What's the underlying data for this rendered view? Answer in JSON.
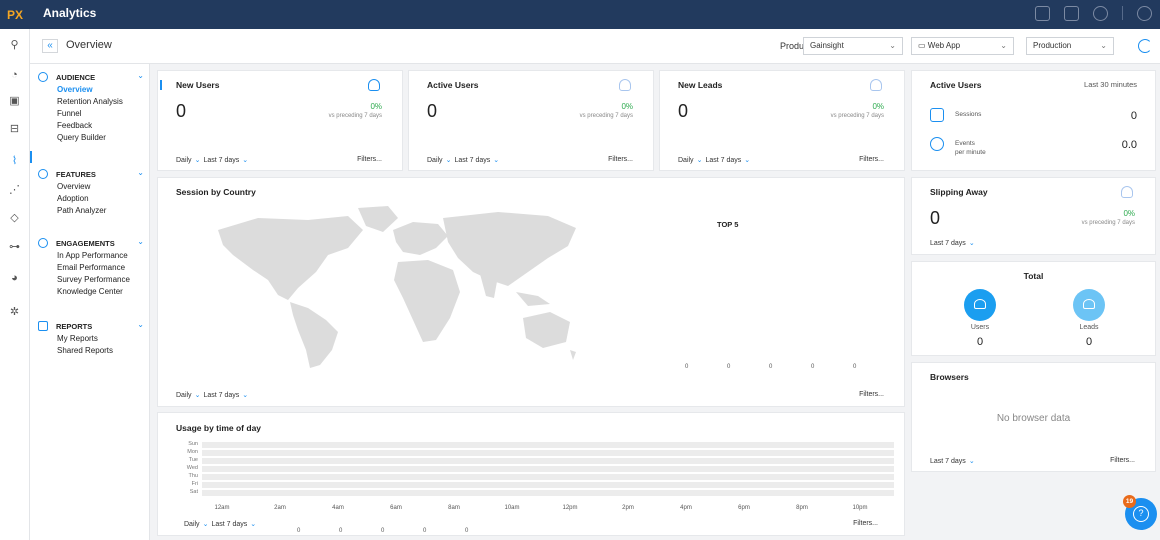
{
  "app": {
    "logo": "PX",
    "title": "Analytics"
  },
  "top_icons": [
    "chat-icon",
    "book-icon",
    "globe-icon",
    "info-icon"
  ],
  "header": {
    "back_glyph": "«",
    "page_title": "Overview",
    "product_label": "Product",
    "product_value": "Gainsight",
    "app_value": "Web App",
    "env_value": "Production"
  },
  "rail_icons": [
    "search-icon",
    "speed-icon",
    "dashboard-icon",
    "briefcase-icon",
    "analytics-icon",
    "route-icon",
    "graduation-icon",
    "hierarchy-icon",
    "pie-chart-icon",
    "settings-icon"
  ],
  "nav": {
    "sections": [
      {
        "title": "AUDIENCE",
        "items": [
          "Overview",
          "Retention Analysis",
          "Funnel",
          "Feedback",
          "Query Builder"
        ],
        "active": 0
      },
      {
        "title": "FEATURES",
        "items": [
          "Overview",
          "Adoption",
          "Path Analyzer"
        ]
      },
      {
        "title": "ENGAGEMENTS",
        "items": [
          "In App Performance",
          "Email Performance",
          "Survey Performance",
          "Knowledge Center"
        ]
      },
      {
        "title": "REPORTS",
        "items": [
          "My Reports",
          "Shared Reports"
        ]
      }
    ]
  },
  "cards": {
    "new_users": {
      "title": "New Users",
      "value": "0",
      "pct": "0%",
      "vs": "vs preceding 7 days",
      "period": "Daily",
      "range": "Last 7 days",
      "filters": "Filters..."
    },
    "active_users": {
      "title": "Active Users",
      "value": "0",
      "pct": "0%",
      "vs": "vs preceding 7 days",
      "period": "Daily",
      "range": "Last 7 days",
      "filters": "Filters..."
    },
    "new_leads": {
      "title": "New Leads",
      "value": "0",
      "pct": "0%",
      "vs": "vs preceding 7 days",
      "period": "Daily",
      "range": "Last 7 days",
      "filters": "Filters..."
    },
    "session_country": {
      "title": "Session by Country",
      "top_label": "TOP 5",
      "top_values": [
        "0",
        "0",
        "0",
        "0",
        "0"
      ],
      "period": "Daily",
      "range": "Last 7 days",
      "filters": "Filters..."
    },
    "usage_time": {
      "title": "Usage by time of day",
      "days": [
        "Sun",
        "Mon",
        "Tue",
        "Wed",
        "Thu",
        "Fri",
        "Sat"
      ],
      "times": [
        "12am",
        "2am",
        "4am",
        "6am",
        "8am",
        "10am",
        "12pm",
        "2pm",
        "4pm",
        "6pm",
        "8pm",
        "10pm"
      ],
      "bottom_values": [
        "0",
        "0",
        "0",
        "0",
        "0"
      ],
      "period": "Daily",
      "range": "Last 7 days",
      "filters": "Filters..."
    },
    "active_now": {
      "title": "Active Users",
      "window": "Last 30 minutes",
      "sessions_label": "Sessions",
      "sessions_value": "0",
      "events_label_1": "Events",
      "events_label_2": "per minute",
      "events_value": "0.0"
    },
    "slipping": {
      "title": "Slipping Away",
      "value": "0",
      "pct": "0%",
      "vs": "vs preceding 7 days",
      "range": "Last 7 days"
    },
    "total": {
      "title": "Total",
      "users_label": "Users",
      "users_value": "0",
      "leads_label": "Leads",
      "leads_value": "0",
      "users_color": "#1b9ef0",
      "leads_color": "#6cc4f5"
    },
    "browsers": {
      "title": "Browsers",
      "empty": "No browser data",
      "range": "Last 7 days",
      "filters": "Filters..."
    }
  },
  "help": {
    "badge": "19",
    "glyph": "?"
  },
  "colors": {
    "topbar": "#223a5e",
    "accent": "#1b8ff0",
    "positive": "#2eaa4f",
    "logo": "#f5a623",
    "badge": "#e96a1a"
  }
}
